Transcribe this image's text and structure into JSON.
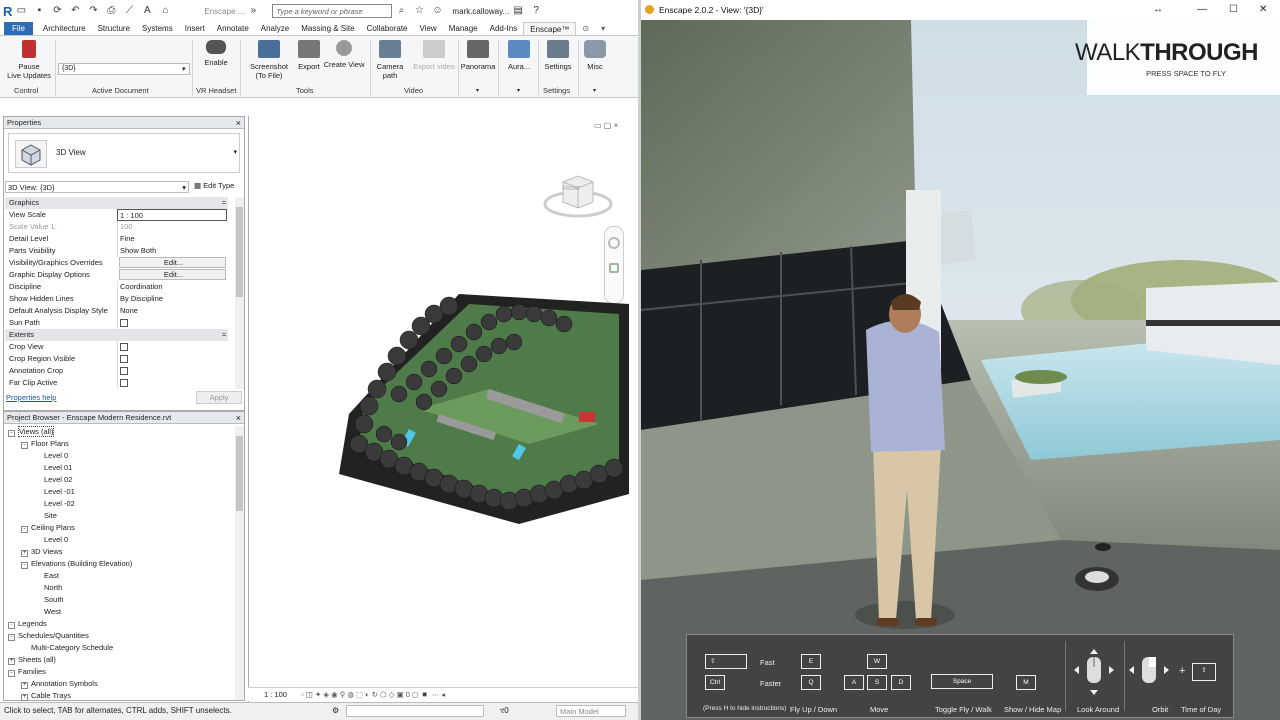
{
  "revit": {
    "logo": "R",
    "doc_title_short": "Enscape ...",
    "search_placeholder": "Type a keyword or phrase",
    "user": "mark.calloway...",
    "tabs": [
      "File",
      "Architecture",
      "Structure",
      "Systems",
      "Insert",
      "Annotate",
      "Analyze",
      "Massing & Site",
      "Collaborate",
      "View",
      "Manage",
      "Add-Ins",
      "Enscape™"
    ],
    "ribbon": {
      "pause_label": "Pause\nLive Updates",
      "control_group": "Control",
      "active_doc_value": "{3D}",
      "active_doc_group": "Active Document",
      "vr_enable": "Enable",
      "vr_group": "VR Headset",
      "screenshot": "Screenshot\n(To File)",
      "export": "Export",
      "create_view": "Create View",
      "tools_group": "Tools",
      "camera_path": "Camera\npath",
      "export_video": "Export video",
      "video_group": "Video",
      "panorama": "Panorama",
      "aura": "Aura...",
      "settings": "Settings",
      "settings_group": "Settings",
      "misc": "Misc"
    },
    "properties": {
      "header": "Properties",
      "type_name": "3D View",
      "instance_selector": "3D View: {3D}",
      "edit_type": "Edit Type",
      "rows": [
        {
          "k": "Graphics",
          "v": "",
          "sec": true
        },
        {
          "k": "View Scale",
          "v": "1 : 100"
        },
        {
          "k": "Scale Value    1:",
          "v": "100",
          "dim": true
        },
        {
          "k": "Detail Level",
          "v": "Fine"
        },
        {
          "k": "Parts Visibility",
          "v": "Show Both"
        },
        {
          "k": "Visibility/Graphics Overrides",
          "v": "Edit...",
          "btn": true
        },
        {
          "k": "Graphic Display Options",
          "v": "Edit...",
          "btn": true
        },
        {
          "k": "Discipline",
          "v": "Coordination"
        },
        {
          "k": "Show Hidden Lines",
          "v": "By Discipline"
        },
        {
          "k": "Default Analysis Display Style",
          "v": "None"
        },
        {
          "k": "Sun Path",
          "v": "",
          "cb": true
        },
        {
          "k": "Extents",
          "v": "",
          "sec": true
        },
        {
          "k": "Crop View",
          "v": "",
          "cb": true
        },
        {
          "k": "Crop Region Visible",
          "v": "",
          "cb": true
        },
        {
          "k": "Annotation Crop",
          "v": "",
          "cb": true
        },
        {
          "k": "Far Clip Active",
          "v": "",
          "cb": true
        }
      ],
      "help_link": "Properties help",
      "apply": "Apply"
    },
    "browser": {
      "header": "Project Browser - Enscape Modern Residence.rvt",
      "items": [
        {
          "t": "Views (all)",
          "lvl": 0,
          "exp": "-"
        },
        {
          "t": "Floor Plans",
          "lvl": 1,
          "exp": "-"
        },
        {
          "t": "Level 0",
          "lvl": 2
        },
        {
          "t": "Level 01",
          "lvl": 2
        },
        {
          "t": "Level 02",
          "lvl": 2
        },
        {
          "t": "Level -01",
          "lvl": 2
        },
        {
          "t": "Level -02",
          "lvl": 2
        },
        {
          "t": "Site",
          "lvl": 2
        },
        {
          "t": "Ceiling Plans",
          "lvl": 1,
          "exp": "-"
        },
        {
          "t": "Level 0",
          "lvl": 2
        },
        {
          "t": "3D Views",
          "lvl": 1,
          "exp": "+"
        },
        {
          "t": "Elevations (Building Elevation)",
          "lvl": 1,
          "exp": "-"
        },
        {
          "t": "East",
          "lvl": 2
        },
        {
          "t": "North",
          "lvl": 2
        },
        {
          "t": "South",
          "lvl": 2
        },
        {
          "t": "West",
          "lvl": 2
        },
        {
          "t": "Legends",
          "lvl": 0,
          "exp": "·"
        },
        {
          "t": "Schedules/Quantities",
          "lvl": 0,
          "exp": "-"
        },
        {
          "t": "Multi-Category Schedule",
          "lvl": 1
        },
        {
          "t": "Sheets (all)",
          "lvl": 0,
          "exp": "+"
        },
        {
          "t": "Families",
          "lvl": 0,
          "exp": "-"
        },
        {
          "t": "Annotation Symbols",
          "lvl": 1,
          "exp": "+"
        },
        {
          "t": "Cable Trays",
          "lvl": 1,
          "exp": "+"
        }
      ]
    },
    "viewcube_face": "FRONT",
    "view_scale": "1 : 100",
    "status_text": "Click to select, TAB for alternates, CTRL adds, SHIFT unselects.",
    "status_count": ":0",
    "status_model": "Main Model"
  },
  "enscape": {
    "window_title": "Enscape 2.0.2 - View: '{3D}'",
    "mode_title_light": "WALK",
    "mode_title_bold": "THROUGH",
    "mode_hint": "PRESS SPACE TO FLY",
    "hud": {
      "fast": "Fast",
      "faster": "Faster",
      "shift_key": "⇧",
      "ctrl_key": "Ctrl",
      "e_key": "E",
      "q_key": "Q",
      "w_key": "W",
      "a_key": "A",
      "s_key": "S",
      "d_key": "D",
      "space_key": "Space",
      "m_key": "M",
      "press_h": "(Press H to hide instructions)",
      "fly_updown": "Fly Up / Down",
      "move": "Move",
      "toggle_fly": "Toggle Fly / Walk",
      "show_map": "Show / Hide Map",
      "look_around": "Look Around",
      "orbit": "Orbit",
      "time_of_day": "Time of Day"
    }
  },
  "colors": {
    "revit_blue": "#2d6db5",
    "hud_bg": "#3c3e40"
  }
}
